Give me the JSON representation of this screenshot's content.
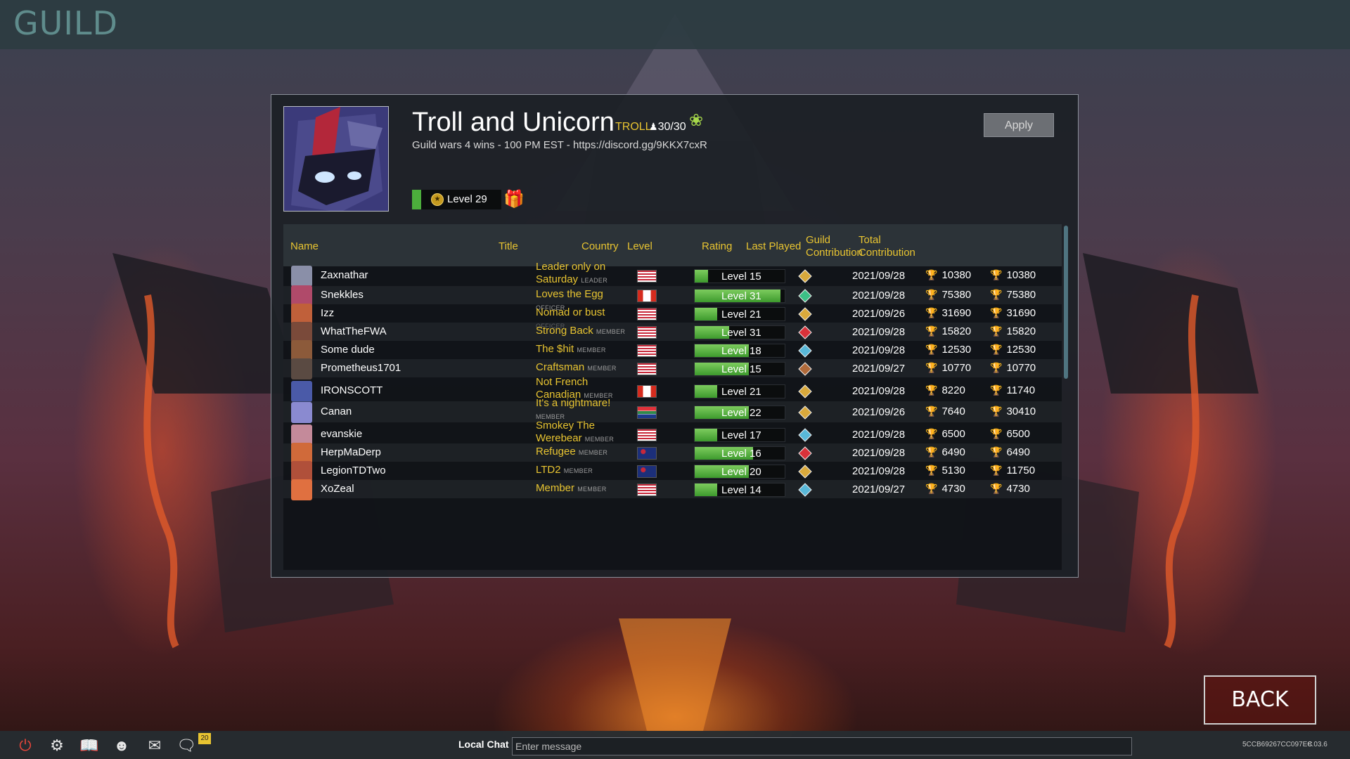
{
  "screen": {
    "heading": "GUILD"
  },
  "guild": {
    "name": "Troll and Unicorn",
    "tag": "TROLL",
    "member_count": "30/30",
    "description": "Guild wars 4 wins - 100 PM EST - https://discord.gg/9KKX7cxR",
    "level_label": "Level 29",
    "level_progress": 0.1,
    "apply_label": "Apply"
  },
  "table": {
    "headers": {
      "name": "Name",
      "title": "Title",
      "country": "Country",
      "level": "Level",
      "rating": "Rating",
      "last_played": "Last Played",
      "guild_contribution": "Guild Contribution",
      "total_contribution": "Total Contribution"
    },
    "rows": [
      {
        "name": "Zaxnathar",
        "title": "Leader only on Saturday",
        "rank": "LEADER",
        "country": "us",
        "level": "Level 15",
        "level_progress": 0.15,
        "rating": "gold-II",
        "last_played": "2021/09/28",
        "guild_contribution": "10380",
        "total_contribution": "10380"
      },
      {
        "name": "Snekkles",
        "title": "Loves the Egg",
        "rank": "OFFICER",
        "country": "ca",
        "level": "Level 31",
        "level_progress": 0.95,
        "rating": "emerald-IV",
        "last_played": "2021/09/28",
        "guild_contribution": "75380",
        "total_contribution": "75380"
      },
      {
        "name": "Izz",
        "title": "Nomad or bust",
        "rank": "OFFICER",
        "country": "us",
        "level": "Level 21",
        "level_progress": 0.25,
        "rating": "gold-I",
        "last_played": "2021/09/26",
        "guild_contribution": "31690",
        "total_contribution": "31690"
      },
      {
        "name": "WhatTheFWA",
        "title": "Strong Back",
        "rank": "MEMBER",
        "country": "us",
        "level": "Level 31",
        "level_progress": 0.38,
        "rating": "ruby-II",
        "last_played": "2021/09/28",
        "guild_contribution": "15820",
        "total_contribution": "15820"
      },
      {
        "name": "Some dude",
        "title": "The $hit",
        "rank": "MEMBER",
        "country": "us",
        "level": "Level 18",
        "level_progress": 0.6,
        "rating": "diamond-III",
        "last_played": "2021/09/28",
        "guild_contribution": "12530",
        "total_contribution": "12530"
      },
      {
        "name": "Prometheus1701",
        "title": "Craftsman",
        "rank": "MEMBER",
        "country": "us",
        "level": "Level 15",
        "level_progress": 0.6,
        "rating": "bronze-II",
        "last_played": "2021/09/27",
        "guild_contribution": "10770",
        "total_contribution": "10770"
      },
      {
        "name": "IRONSCOTT",
        "title": "Not French Canadian",
        "rank": "MEMBER",
        "country": "ca",
        "level": "Level 21",
        "level_progress": 0.25,
        "rating": "gold-III",
        "last_played": "2021/09/28",
        "guild_contribution": "8220",
        "total_contribution": "11740"
      },
      {
        "name": "Canan",
        "title": "It's a nightmare!",
        "rank": "MEMBER",
        "country": "za",
        "level": "Level 22",
        "level_progress": 0.6,
        "rating": "gold-II",
        "last_played": "2021/09/26",
        "guild_contribution": "7640",
        "total_contribution": "30410"
      },
      {
        "name": "evanskie",
        "title": "Smokey The Werebear",
        "rank": "MEMBER",
        "country": "us",
        "level": "Level 17",
        "level_progress": 0.25,
        "rating": "diamond-III",
        "last_played": "2021/09/28",
        "guild_contribution": "6500",
        "total_contribution": "6500"
      },
      {
        "name": "HerpMaDerp",
        "title": "Refugee",
        "rank": "MEMBER",
        "country": "au",
        "level": "Level 16",
        "level_progress": 0.65,
        "rating": "ruby-II",
        "last_played": "2021/09/28",
        "guild_contribution": "6490",
        "total_contribution": "6490"
      },
      {
        "name": "LegionTDTwo",
        "title": "LTD2",
        "rank": "MEMBER",
        "country": "au",
        "level": "Level 20",
        "level_progress": 0.6,
        "rating": "gold-III",
        "last_played": "2021/09/28",
        "guild_contribution": "5130",
        "total_contribution": "11750"
      },
      {
        "name": "XoZeal",
        "title": "Member",
        "rank": "MEMBER",
        "country": "us",
        "level": "Level 14",
        "level_progress": 0.25,
        "rating": "diamond-III",
        "last_played": "2021/09/27",
        "guild_contribution": "4730",
        "total_contribution": "4730"
      }
    ]
  },
  "back_label": "BACK",
  "bottom_bar": {
    "icons": [
      "power-icon",
      "gear-icon",
      "book-icon",
      "discord-icon",
      "mail-icon",
      "chat-bubble-icon"
    ],
    "notification_count": "20",
    "local_chat_label": "Local Chat",
    "chat_placeholder": "Enter message",
    "build_id": "5CCB69267CC097EC",
    "version": "8.03.6"
  },
  "colors": {
    "accent_gold": "#e8c431",
    "level_green": "#4cae3c",
    "panel_bg": "#1c2026",
    "header_teal": "#5f8c8c"
  }
}
